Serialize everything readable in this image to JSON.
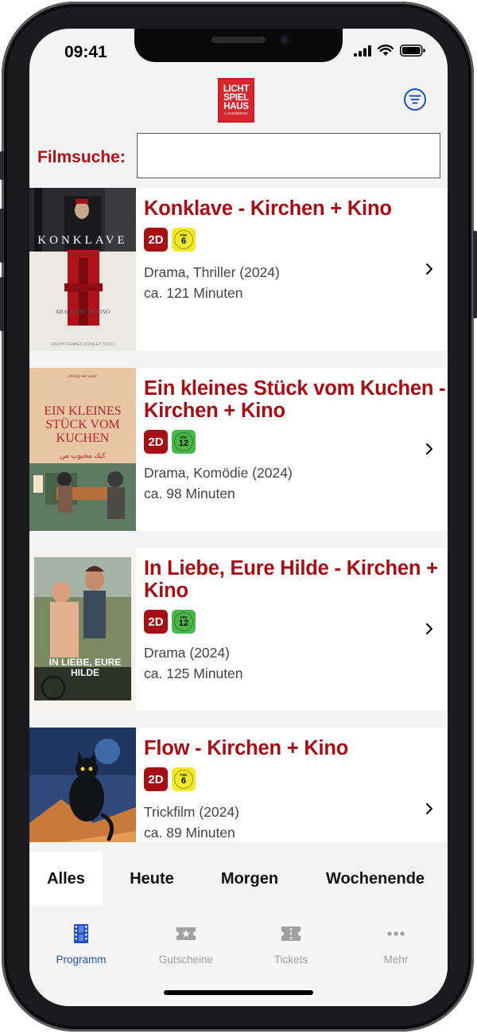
{
  "status_bar": {
    "time": "09:41"
  },
  "header": {
    "logo": {
      "line1": "LICHT",
      "line2": "SPIEL",
      "line3": "HAUS",
      "line4": "LANDSBERG"
    }
  },
  "search": {
    "label": "Filmsuche:",
    "value": "",
    "placeholder": ""
  },
  "movies": [
    {
      "title": "Konklave - Kirchen + Kino",
      "format": "2D",
      "fsk": "6",
      "fsk_top": "FSK",
      "fsk_color": "#f3e92b",
      "genre": "Drama, Thriller (2024)",
      "duration": "ca. 121 Minuten",
      "poster_text": "KONKLAVE"
    },
    {
      "title": "Ein kleines Stück vom Kuchen - Kirchen + Kino",
      "format": "2D",
      "fsk": "12",
      "fsk_top": "FSK",
      "fsk_color": "#49b848",
      "genre": "Drama, Komödie (2024)",
      "duration": "ca. 98 Minuten",
      "poster_text": "EIN KLEINES STÜCK VOM KUCHEN"
    },
    {
      "title": "In Liebe, Eure Hilde - Kirchen + Kino",
      "format": "2D",
      "fsk": "12",
      "fsk_top": "FSK",
      "fsk_color": "#49b848",
      "genre": "Drama (2024)",
      "duration": "ca. 125 Minuten",
      "poster_text": "IN LIEBE, EURE HILDE"
    },
    {
      "title": "Flow - Kirchen + Kino",
      "format": "2D",
      "fsk": "6",
      "fsk_top": "FSK",
      "fsk_color": "#f3e92b",
      "genre": "Trickfilm (2024)",
      "duration": "ca. 89 Minuten",
      "poster_text": ""
    }
  ],
  "day_tabs": [
    {
      "label": "Alles",
      "active": true
    },
    {
      "label": "Heute",
      "active": false
    },
    {
      "label": "Morgen",
      "active": false
    },
    {
      "label": "Wochenende",
      "active": false
    }
  ],
  "tab_bar": [
    {
      "label": "Programm",
      "icon": "film-icon",
      "active": true
    },
    {
      "label": "Gutscheine",
      "icon": "voucher-icon",
      "active": false
    },
    {
      "label": "Tickets",
      "icon": "ticket-icon",
      "active": false
    },
    {
      "label": "Mehr",
      "icon": "more-icon",
      "active": false
    }
  ],
  "colors": {
    "brand_red": "#a50e14",
    "accent_blue": "#1e4fc4",
    "logo_red": "#d7262e"
  }
}
